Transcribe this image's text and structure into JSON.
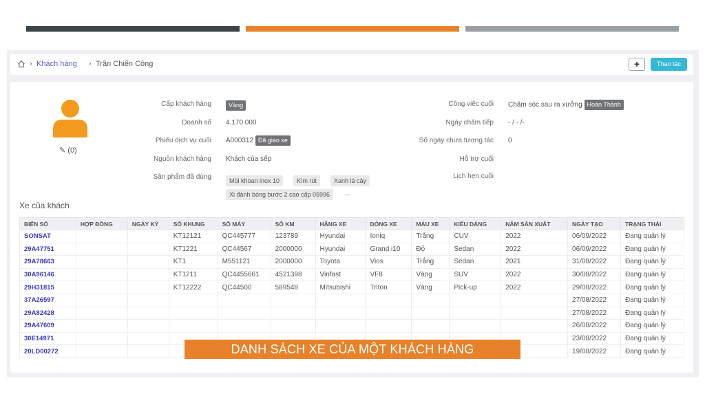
{
  "breadcrumb": {
    "parent": "Khách hàng",
    "current": "Trần Chiến Công"
  },
  "header": {
    "plus_label": "+",
    "action_label": "Thao tác"
  },
  "profile": {
    "attachments": "(0)",
    "left_fields": {
      "tier_label": "Cấp khách hàng",
      "tier_value": "Vàng",
      "revenue_label": "Doanh số",
      "revenue_value": "4.170.000",
      "last_ticket_label": "Phiếu dịch vụ cuối",
      "last_ticket_value": "A000312",
      "last_ticket_badge": "Đã giao xe",
      "source_label": "Nguồn khách hàng",
      "source_value": "Khách của sếp",
      "products_label": "Sản phẩm đã dùng",
      "products": [
        "Mũi khoan inox 10",
        "Kìm rút",
        "Xanh lá cây",
        "Xi đánh bóng bước 2 cao cấp 05996"
      ],
      "products_more": "..."
    },
    "right_fields": {
      "last_job_label": "Công việc cuối",
      "last_job_value": "Chăm sóc sau ra xưởng",
      "last_job_badge": "Hoàn Thành",
      "last_care_label": "Ngày chăm tiếp",
      "last_care_value": "- / - /-",
      "no_contact_label": "Số ngày chưa tương tác",
      "no_contact_value": "0",
      "last_support_label": "Hỗ trợ cuối",
      "last_appt_label": "Lịch hẹn cuối"
    }
  },
  "cars": {
    "title": "Xe của khách",
    "columns": [
      "BIỂN SỐ",
      "HỢP ĐỒNG",
      "NGÀY KÝ",
      "SỐ KHUNG",
      "SỐ MÁY",
      "SỐ KM",
      "HÃNG XE",
      "DÒNG XE",
      "MÀU XE",
      "KIỂU DÁNG",
      "NĂM SẢN XUẤT",
      "NGÀY TẠO",
      "TRẠNG THÁI"
    ],
    "rows": [
      [
        "SONSAT",
        "",
        "",
        "KT12121",
        "QC445777",
        "123789",
        "Hyundai",
        "Ioniq",
        "Trắng",
        "CUV",
        "2022",
        "06/09/2022",
        "Đang quản lý"
      ],
      [
        "29A47751",
        "",
        "",
        "KT1221",
        "QC44567",
        "2000000",
        "Hyundai",
        "Grand i10",
        "Đỏ",
        "Sedan",
        "2022",
        "06/09/2022",
        "Đang quản lý"
      ],
      [
        "29A78663",
        "",
        "",
        "KT1",
        "M551121",
        "2000000",
        "Toyota",
        "Vios",
        "Trắng",
        "Sedan",
        "2021",
        "31/08/2022",
        "Đang quản lý"
      ],
      [
        "30A96146",
        "",
        "",
        "KT1211",
        "QC4455661",
        "4521398",
        "Vinfast",
        "VF8",
        "Vàng",
        "SUV",
        "2022",
        "30/08/2022",
        "Đang quản lý"
      ],
      [
        "29H31815",
        "",
        "",
        "KT12222",
        "QC44500",
        "589548",
        "Mitsubishi",
        "Triton",
        "Vàng",
        "Pick-up",
        "2022",
        "29/08/2022",
        "Đang quản lý"
      ],
      [
        "37A26597",
        "",
        "",
        "",
        "",
        "",
        "",
        "",
        "",
        "",
        "",
        "27/08/2022",
        "Đang quản lý"
      ],
      [
        "29A82428",
        "",
        "",
        "",
        "",
        "",
        "",
        "",
        "",
        "",
        "",
        "27/08/2022",
        "Đang quản lý"
      ],
      [
        "29A47609",
        "",
        "",
        "",
        "",
        "",
        "",
        "",
        "",
        "",
        "",
        "26/08/2022",
        "Đang quản lý"
      ],
      [
        "30E14971",
        "",
        "",
        "",
        "",
        "",
        "",
        "",
        "",
        "",
        "",
        "23/08/2022",
        "Đang quản lý"
      ],
      [
        "20LD00272",
        "",
        "",
        "",
        "",
        "",
        "",
        "",
        "",
        "",
        "",
        "19/08/2022",
        "Đang quản lý"
      ]
    ]
  },
  "caption": "DANH SÁCH XE CỦA MỘT KHÁCH HÀNG",
  "colors": {
    "accent_orange": "#e8822a",
    "dark_bar": "#3d4449",
    "grey_bar": "#9aa0a6",
    "action_blue": "#35b8d4",
    "plate_blue": "#3b3bb8"
  }
}
